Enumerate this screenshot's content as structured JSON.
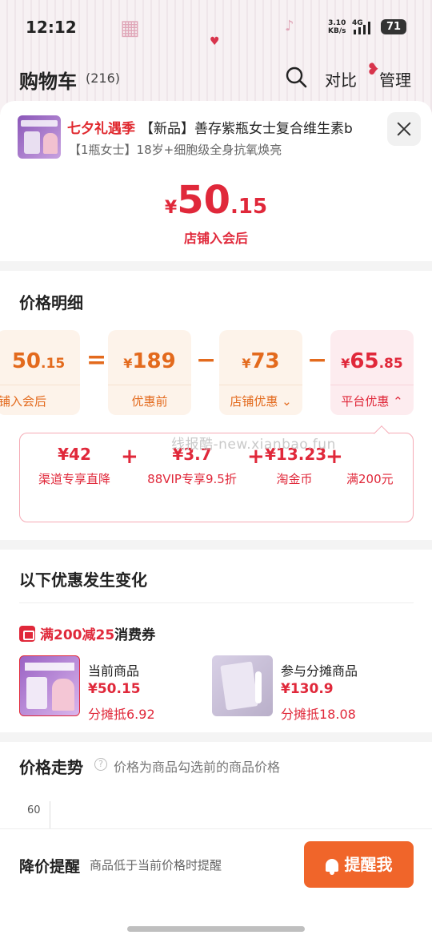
{
  "status": {
    "time": "12:12",
    "speed": "3.10",
    "speed_unit": "KB/s",
    "net": "4G",
    "battery": "71"
  },
  "header": {
    "title": "购物车",
    "count": "(216)",
    "compare": "对比",
    "manage": "管理"
  },
  "product": {
    "tag": "七夕礼遇季",
    "title": "【新品】善存紫瓶女士复合维生素b",
    "sub": "【1瓶女士】18岁+细胞级全身抗氧焕亮"
  },
  "price": {
    "yen": "¥",
    "int": "50",
    "dec": ".15",
    "note": "店铺入会后"
  },
  "detail": {
    "title": "价格明细",
    "chips": [
      {
        "yen": "",
        "int": "50",
        "dec": ".15",
        "label": "铺入会后"
      },
      {
        "yen": "¥",
        "int": "189",
        "dec": "",
        "label": "优惠前"
      },
      {
        "yen": "¥",
        "int": "73",
        "dec": "",
        "label": "店铺优惠 ⌄"
      },
      {
        "yen": "¥",
        "int": "65",
        "dec": ".85",
        "label": "平台优惠 ⌃"
      }
    ],
    "ops": [
      "=",
      "−",
      "−"
    ],
    "platform": [
      {
        "amount": "¥42",
        "label": "渠道专享直降"
      },
      {
        "amount": "¥3.7",
        "label": "88VIP专享9.5折"
      },
      {
        "amount": "¥13.23",
        "label": "淘金币"
      },
      {
        "amount": "",
        "label": "满200元"
      }
    ],
    "plus": "+"
  },
  "watermark": "线报酷-new.xianbao.fun",
  "change": {
    "title": "以下优惠发生变化",
    "coupon_red": "满200减25",
    "coupon_black": "消费券",
    "items": [
      {
        "title": "当前商品",
        "price": "¥50.15",
        "share": "分摊抵6.92"
      },
      {
        "title": "参与分摊商品",
        "price": "¥130.9",
        "share": "分摊抵18.08"
      }
    ]
  },
  "trend": {
    "title": "价格走势",
    "hint": "?",
    "desc": "价格为商品勾选前的商品价格",
    "ytick": "60"
  },
  "bottom": {
    "title": "降价提醒",
    "desc": "商品低于当前价格时提醒",
    "button": "提醒我"
  },
  "colors": {
    "accent": "#e0283a",
    "orange": "#e36a1d",
    "button": "#f0652a"
  }
}
